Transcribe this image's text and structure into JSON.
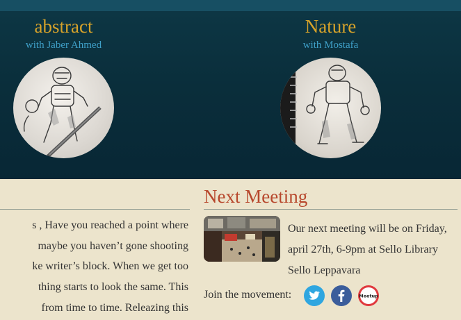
{
  "cards": [
    {
      "title": "abstract",
      "subtitle": "with Jaber Ahmed",
      "image": "robot-sketch-with-pencil"
    },
    {
      "title": "Nature",
      "subtitle": "with Mostafa",
      "image": "robot-sketch-on-sketchbook"
    }
  ],
  "article": {
    "lines": [
      "s , Have you reached a point where",
      "maybe you haven’t gone shooting",
      "ke writer’s block. When we get too",
      "thing starts to look the same. This",
      "from time to time. Releazing this"
    ]
  },
  "meeting": {
    "title": "Next Meeting",
    "photo": "mall-interior-photo",
    "text": "Our next meeting will be on Friday, april 27th, 6-9pm at Sello Library Sello Leppavara"
  },
  "social": {
    "join_label": "Join the movement:",
    "links": [
      {
        "name": "twitter",
        "icon": "twitter-icon",
        "color": "#2fa6e0"
      },
      {
        "name": "facebook",
        "icon": "facebook-icon",
        "color": "#3b5d9b"
      },
      {
        "name": "meetup",
        "icon": "meetup-icon",
        "color": "#e0393e",
        "label": "Meetup"
      }
    ]
  },
  "colors": {
    "header_bg": "#0a2e3b",
    "card_title": "#d6a22a",
    "card_subtitle": "#3fa0c8",
    "section_title": "#b7472c",
    "page_bg": "#ece4cc"
  }
}
